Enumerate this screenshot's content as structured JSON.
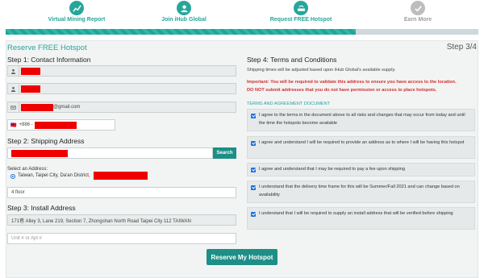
{
  "steps": [
    {
      "label": "Virtual Mining Report",
      "icon": "chart-icon",
      "active": true
    },
    {
      "label": "Join iHub Global",
      "icon": "user-icon",
      "active": true
    },
    {
      "label": "Request FREE Hotspot",
      "icon": "router-icon",
      "active": true
    },
    {
      "label": "Earn More",
      "icon": "check-icon",
      "active": false
    }
  ],
  "progress": {
    "percent": 74
  },
  "header": {
    "title": "Reserve FREE Hotspot",
    "step": "Step 3/4"
  },
  "contact": {
    "heading": "Step 1: Contact Information",
    "email_suffix": "@gmail.com",
    "phone_code": "+886 -",
    "flag": "🇹🇼"
  },
  "shipping": {
    "heading": "Step 2: Shipping Address",
    "search_label": "Search",
    "select_label": "Select an Address:",
    "option_text": "Taiwan, Taipei City, Da'an District,",
    "floor_value": "4 floor"
  },
  "install": {
    "heading": "Step 3: Install Address",
    "address_value": "171巷 Alley 3, Lane 219, Section 7, Zhongshan North Road Taipei City 112 TAIWAN",
    "unit_placeholder": "Unit # or Apt #"
  },
  "terms": {
    "heading": "Step 4: Terms and Conditions",
    "supply_note": "Shipping times will be adjusted based upon iHub Global's available supply.",
    "warning_1": "Important: You will be required to validate this address to ensure you have access to the location.",
    "warning_2": "DO NOT submit addresses that you do not have permission or access to place hotspots.",
    "doc_title": "TERMS AND AGREEMENT DOCUMENT",
    "items": [
      "I agree to the terms in the document above to all risks and changes that may occur from today and until the time the hotspots become available",
      "I agree and understand I will be required to provide an address as to where I will be having this hotspot",
      "I agree and understand that I may be required to pay a fee upon shipping",
      "I understand that the delivery time frame for this will be Summer/Fall 2021 and can change based on availability",
      "I understand that I will be required to supply an install address that will be verified before shipping"
    ]
  },
  "submit_label": "Reserve My Hotspot",
  "colors": {
    "accent": "#26a69a",
    "button": "#1e8f86",
    "warning": "#d32f2f",
    "redaction": "#ee0000"
  }
}
